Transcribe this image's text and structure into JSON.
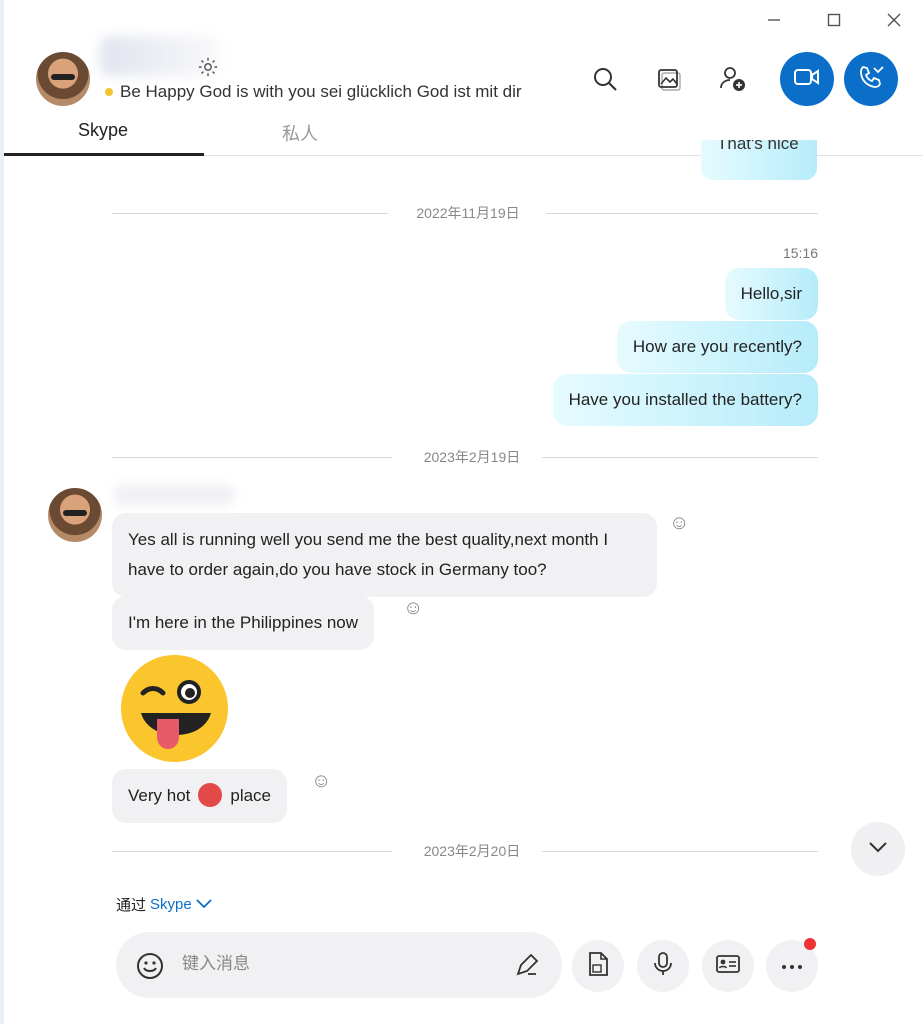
{
  "header": {
    "status_text": "Be Happy God is with you sei glücklich God ist mit dir",
    "colors": {
      "accent": "#0b6fc9"
    }
  },
  "tabs": [
    {
      "label": "Skype",
      "active": true
    },
    {
      "label": "私人",
      "active": false
    }
  ],
  "messages": {
    "cut_off_text": "That's nice",
    "date_1": "2022年11月19日",
    "time_1": "15:16",
    "outgoing": [
      "Hello,sir",
      "How are you recently?",
      "Have you installed the battery?"
    ],
    "date_2": "2023年2月19日",
    "incoming": [
      "Yes all is running well you send me the best quality,next month I have to order again,do you have stock in Germany too?",
      "I'm here in the Philippines now"
    ],
    "hot_before": "Very hot",
    "hot_after": "place",
    "date_3": "2023年2月20日"
  },
  "composer": {
    "via_label": "通过",
    "via_link": "Skype",
    "placeholder": "键入消息"
  },
  "icons": [
    "minimize-icon",
    "maximize-icon",
    "close-icon",
    "gear-icon",
    "search-icon",
    "gallery-icon",
    "add-user-icon",
    "video-call-icon",
    "audio-call-icon",
    "emoji-icon",
    "pen-icon",
    "file-icon",
    "mic-icon",
    "contact-card-icon",
    "more-icon",
    "chevron-down-icon"
  ]
}
